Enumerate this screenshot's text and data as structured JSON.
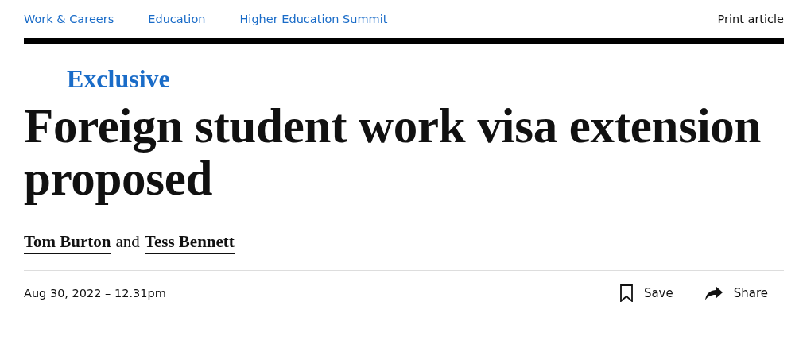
{
  "nav": {
    "links": [
      "Work & Careers",
      "Education",
      "Higher Education Summit"
    ],
    "print": "Print article"
  },
  "kicker": "Exclusive",
  "headline": "Foreign student work visa extension proposed",
  "byline": {
    "authors": [
      "Tom Burton",
      "Tess Bennett"
    ],
    "joiner": "and"
  },
  "date": "Aug 30, 2022 – 12.31pm",
  "actions": [
    {
      "kind": "save",
      "label": "Save"
    },
    {
      "kind": "share",
      "label": "Share"
    }
  ]
}
